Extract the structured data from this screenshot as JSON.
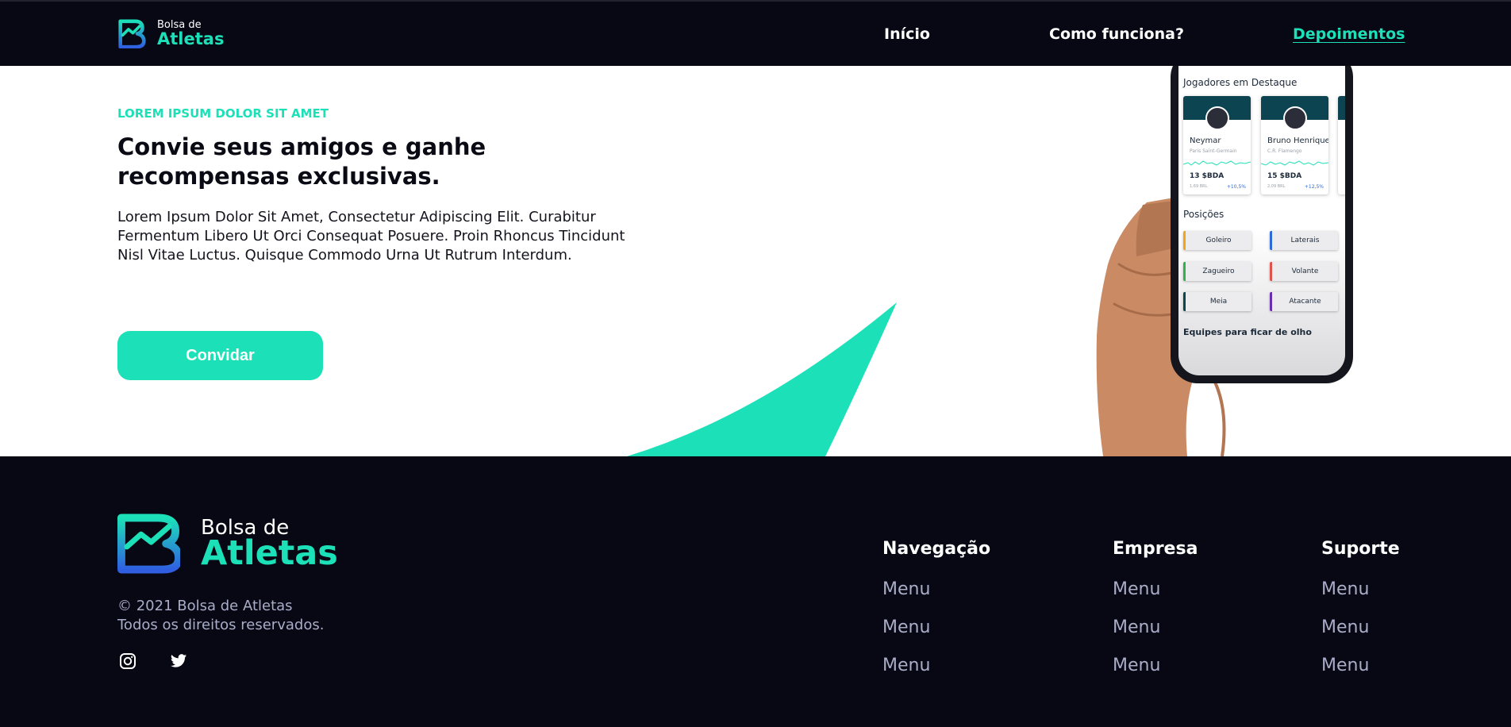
{
  "header": {
    "brand_small": "Bolsa de",
    "brand_big": "Atletas",
    "nav": [
      {
        "label": "Início"
      },
      {
        "label": "Como funciona?"
      },
      {
        "label": "Depoimentos",
        "active": true
      }
    ]
  },
  "hero": {
    "kicker": "LOREM IPSUM DOLOR SIT AMET",
    "title": "Convie seus amigos e ganhe recompensas exclusivas.",
    "description": "Lorem Ipsum Dolor Sit Amet, Consectetur Adipiscing Elit. Curabitur Fermentum Libero Ut Orci Consequat Posuere. Proin Rhoncus Tincidunt Nisl Vitae Luctus. Quisque Commodo Urna Ut Rutrum Interdum.",
    "cta_label": "Convidar"
  },
  "phone_app": {
    "featured_title": "Jogadores em Destaque",
    "players": [
      {
        "name": "Neymar",
        "club": "Paris Saint-Germain",
        "price": "13 $BDA",
        "brl": "1,69 BRL",
        "change": "+10,5%"
      },
      {
        "name": "Bruno Henrique",
        "club": "C.R. Flamengo",
        "price": "15 $BDA",
        "brl": "2,09 BRL",
        "change": "+12,5%"
      }
    ],
    "positions_title": "Posições",
    "positions": [
      {
        "label": "Goleiro",
        "color": "#f2a516"
      },
      {
        "label": "Laterais",
        "color": "#2d6ad8"
      },
      {
        "label": "Zagueiro",
        "color": "#2fb34a"
      },
      {
        "label": "Volante",
        "color": "#e0524c"
      },
      {
        "label": "Meia",
        "color": "#0d4452"
      },
      {
        "label": "Atacante",
        "color": "#6a2fb0"
      }
    ],
    "teams_title": "Equipes para ficar de olho"
  },
  "footer": {
    "brand_small": "Bolsa de",
    "brand_big": "Atletas",
    "copyright_line1": "© 2021 Bolsa de Atletas",
    "copyright_line2": "Todos os direitos reservados.",
    "social": [
      "instagram-icon",
      "twitter-icon"
    ],
    "columns": [
      {
        "title": "Navegação",
        "links": [
          "Menu",
          "Menu",
          "Menu"
        ]
      },
      {
        "title": "Empresa",
        "links": [
          "Menu",
          "Menu",
          "Menu"
        ]
      },
      {
        "title": "Suporte",
        "links": [
          "Menu",
          "Menu",
          "Menu"
        ]
      }
    ]
  },
  "colors": {
    "accent": "#1ce0b8",
    "dark_bg": "#080814",
    "muted_text": "#a9adc8",
    "logo_blue": "#2f5fe0"
  }
}
